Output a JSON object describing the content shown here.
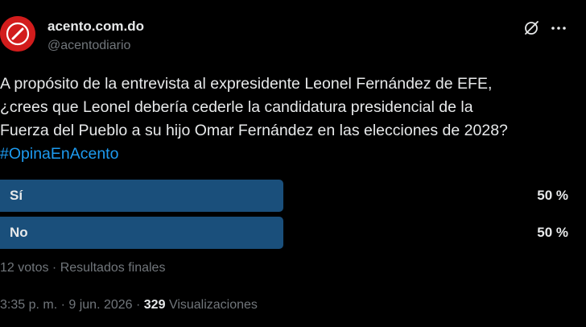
{
  "account": {
    "display_name": "acento.com.do",
    "handle": "@acentodiario",
    "avatar_color": "#d21c1c"
  },
  "actions": {
    "grok_icon": "slashed-circle-icon",
    "more_icon": "more-dots-icon",
    "more_label": "···"
  },
  "tweet": {
    "lines": [
      "A propósito de la entrevista al expresidente Leonel Fernández de EFE,",
      "¿crees que Leonel debería cederle la candidatura presidencial de la",
      "Fuerza del Pueblo a su hijo Omar Fernández en las elecciones de 2028?"
    ],
    "hashtag": "#OpinaEnAcento"
  },
  "poll": {
    "options": [
      {
        "label": "Sí",
        "percent_text": "50 %",
        "share": 0.5
      },
      {
        "label": "No",
        "percent_text": "50 %",
        "share": 0.5
      }
    ],
    "bar_color": "#1a4f7b",
    "votes": "12 votos",
    "separator": " · ",
    "status": "Resultados finales"
  },
  "meta": {
    "time": "3:35 p. m.",
    "separator": " · ",
    "date": "9 jun. 2026",
    "views_count": "329",
    "views_label": "Visualizaciones"
  },
  "colors": {
    "background": "#000000",
    "text": "#e7e9ea",
    "secondary": "#71767b",
    "link": "#1d9bf0"
  }
}
